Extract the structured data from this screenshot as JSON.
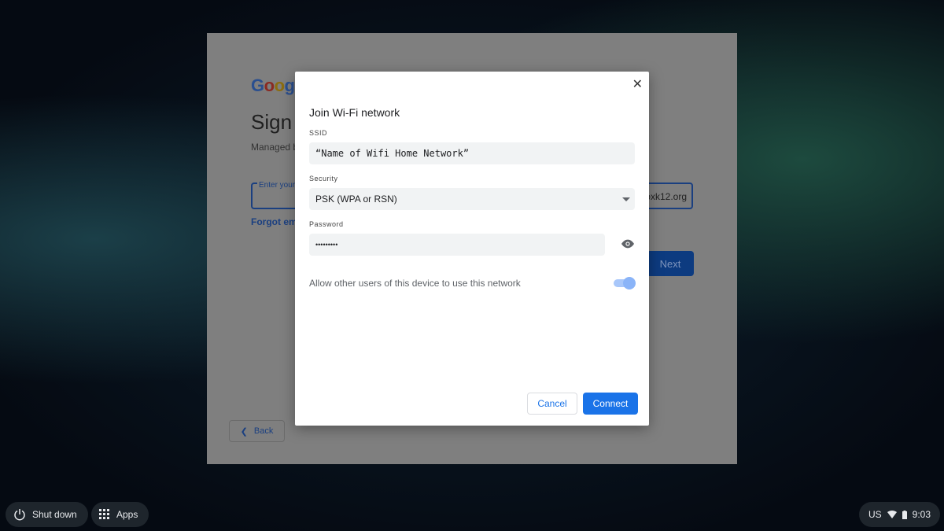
{
  "background_page": {
    "logo": "Google",
    "title": "Sign in",
    "managed": "Managed by",
    "email_label": "Enter your email",
    "email_value": "oxk12.org",
    "forgot": "Forgot email?",
    "next": "Next",
    "back": "Back"
  },
  "dialog": {
    "title": "Join Wi-Fi network",
    "ssid_label": "SSID",
    "ssid_value": "“Name of Wifi Home Network”",
    "security_label": "Security",
    "security_value": "PSK (WPA or RSN)",
    "password_label": "Password",
    "password_value": "•••••••••",
    "allow_label": "Allow other users of this device to use this network",
    "allow_on": true,
    "cancel": "Cancel",
    "connect": "Connect",
    "accent": "#1a73e8"
  },
  "shelf": {
    "shutdown": "Shut down",
    "apps": "Apps",
    "locale": "US",
    "time": "9:03"
  }
}
